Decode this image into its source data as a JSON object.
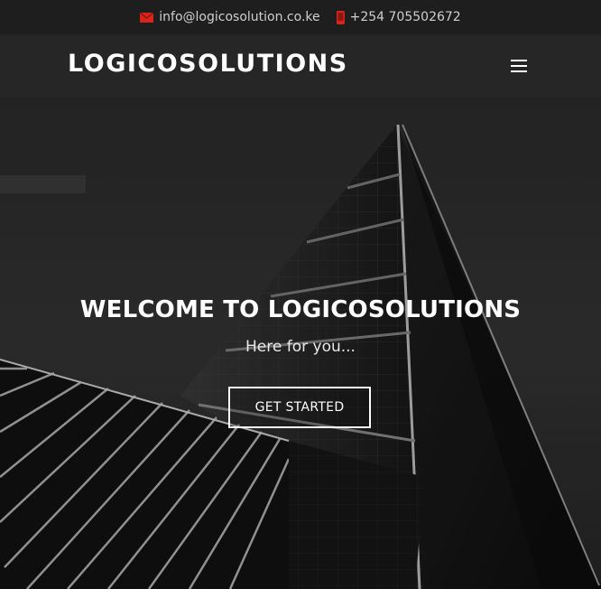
{
  "topbar": {
    "email": "info@logicosolution.co.ke",
    "phone": "+254 705502672",
    "icon_color": "#d9241c"
  },
  "header": {
    "brand": "LOGICOSOLUTIONS",
    "menu_icon": "hamburger-icon"
  },
  "hero": {
    "title": "WELCOME TO LOGICOSOLUTIONS",
    "subtitle": "Here for you...",
    "cta_label": "GET STARTED"
  }
}
